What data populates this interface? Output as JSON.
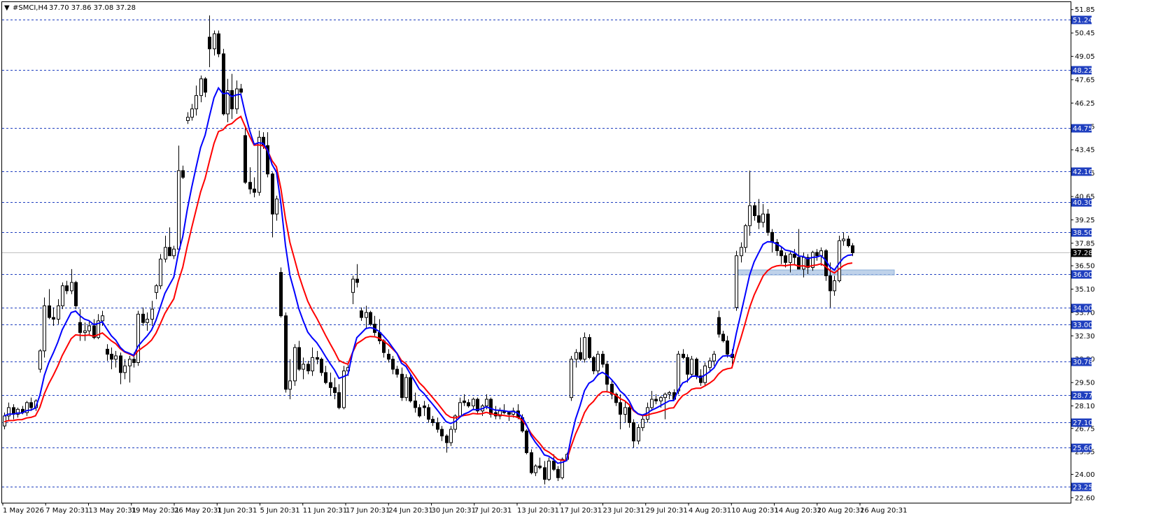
{
  "header": {
    "symbol_tf": "#SMCI,H4",
    "ohlc": "37.70 37.86 37.08 37.28"
  },
  "colors": {
    "background": "#ffffff",
    "frame": "#000000",
    "grid": "#1f3fbf",
    "level_tag": "#1f3fbf",
    "price_line": "#c0c0c0",
    "bull_body": "#ffffff",
    "bear_body": "#000000",
    "ma_fast": "#0000ff",
    "ma_slow": "#ff0000",
    "zone": "#a9c3e3"
  },
  "chart_data": {
    "type": "candlestick",
    "symbol": "#SMCI",
    "timeframe": "H4",
    "ylim": [
      22.3,
      52.3
    ],
    "y_ticks": [
      "51.85",
      "50.45",
      "49.05",
      "47.65",
      "46.25",
      "44.85",
      "43.45",
      "42.05",
      "40.65",
      "39.25",
      "37.85",
      "36.50",
      "35.10",
      "33.70",
      "32.30",
      "30.90",
      "29.50",
      "28.10",
      "26.75",
      "25.35",
      "24.00",
      "22.60"
    ],
    "level_lines": [
      "51.24",
      "48.22",
      "44.75",
      "42.16",
      "40.30",
      "38.50",
      "36.00",
      "34.00",
      "33.00",
      "30.78",
      "28.77",
      "27.10",
      "25.60",
      "23.25"
    ],
    "current_price": "37.28",
    "x_labels": [
      "1 May 2026",
      "7 May 20:31",
      "13 May 20:31",
      "19 May 20:31",
      "26 May 20:31",
      "1 Jun 20:31",
      "5 Jun 20:31",
      "11 Jun 20:31",
      "17 Jun 20:31",
      "24 Jun 20:31",
      "30 Jun 20:31",
      "7 Jul 20:31",
      "13 Jul 20:31",
      "17 Jul 20:31",
      "23 Jul 20:31",
      "29 Jul 20:31",
      "4 Aug 20:31",
      "10 Aug 20:31",
      "14 Aug 20:31",
      "20 Aug 20:31",
      "26 Aug 20:31"
    ],
    "highlight_zone": {
      "low": 35.95,
      "high": 36.25
    },
    "ohlc": [
      [
        26.9,
        27.7,
        26.7,
        27.5
      ],
      [
        27.5,
        28.3,
        27.2,
        28.0
      ],
      [
        28.0,
        28.2,
        27.3,
        27.6
      ],
      [
        27.6,
        28.0,
        27.4,
        27.9
      ],
      [
        27.9,
        28.1,
        27.6,
        27.7
      ],
      [
        27.7,
        28.4,
        27.5,
        28.3
      ],
      [
        28.3,
        28.6,
        27.8,
        28.0
      ],
      [
        28.0,
        28.5,
        27.8,
        28.4
      ],
      [
        30.3,
        31.5,
        30.1,
        31.4
      ],
      [
        31.4,
        34.6,
        31.0,
        34.1
      ],
      [
        34.1,
        35.1,
        33.3,
        33.4
      ],
      [
        33.4,
        34.0,
        32.9,
        33.3
      ],
      [
        33.3,
        34.5,
        33.0,
        34.1
      ],
      [
        34.1,
        35.5,
        33.9,
        35.3
      ],
      [
        35.3,
        35.6,
        34.8,
        35.0
      ],
      [
        35.0,
        36.3,
        34.8,
        35.5
      ],
      [
        35.5,
        35.6,
        33.9,
        34.1
      ],
      [
        33.1,
        33.9,
        32.0,
        32.5
      ],
      [
        32.5,
        33.1,
        32.0,
        32.6
      ],
      [
        32.6,
        33.2,
        32.3,
        32.9
      ],
      [
        32.9,
        33.3,
        32.1,
        32.2
      ],
      [
        32.2,
        33.6,
        32.1,
        33.2
      ],
      [
        33.2,
        33.8,
        32.9,
        33.5
      ],
      [
        31.5,
        31.8,
        30.8,
        31.2
      ],
      [
        31.2,
        31.6,
        30.3,
        30.9
      ],
      [
        30.9,
        31.4,
        30.4,
        31.1
      ],
      [
        31.1,
        31.3,
        29.4,
        30.1
      ],
      [
        30.1,
        30.9,
        29.7,
        30.5
      ],
      [
        30.5,
        31.1,
        29.5,
        30.9
      ],
      [
        30.9,
        31.3,
        30.4,
        30.7
      ],
      [
        30.7,
        33.8,
        30.5,
        33.6
      ],
      [
        33.6,
        34.0,
        32.9,
        33.1
      ],
      [
        33.1,
        33.7,
        32.6,
        33.3
      ],
      [
        33.3,
        34.4,
        32.9,
        33.9
      ],
      [
        34.9,
        35.4,
        34.5,
        35.3
      ],
      [
        35.3,
        37.2,
        35.1,
        36.9
      ],
      [
        36.9,
        38.3,
        36.7,
        37.6
      ],
      [
        37.6,
        38.8,
        37.2,
        37.1
      ],
      [
        37.1,
        37.7,
        36.9,
        37.5
      ],
      [
        37.5,
        43.7,
        37.3,
        42.2
      ],
      [
        42.2,
        42.5,
        41.7,
        41.8
      ],
      [
        45.2,
        45.7,
        45.0,
        45.4
      ],
      [
        45.4,
        46.2,
        45.2,
        45.9
      ],
      [
        45.9,
        47.3,
        45.5,
        46.7
      ],
      [
        46.7,
        47.9,
        46.3,
        47.7
      ],
      [
        47.7,
        47.8,
        46.6,
        46.9
      ],
      [
        50.2,
        51.5,
        48.4,
        49.5
      ],
      [
        49.5,
        50.6,
        49.1,
        50.4
      ],
      [
        50.4,
        50.6,
        49.0,
        49.2
      ],
      [
        49.2,
        49.5,
        45.5,
        45.6
      ],
      [
        45.6,
        47.7,
        45.1,
        47.0
      ],
      [
        47.0,
        48.0,
        45.3,
        45.9
      ],
      [
        45.9,
        47.6,
        45.6,
        47.1
      ],
      [
        47.1,
        47.4,
        46.8,
        46.9
      ],
      [
        44.3,
        44.9,
        41.4,
        41.5
      ],
      [
        41.5,
        42.4,
        40.8,
        41.1
      ],
      [
        41.1,
        41.8,
        40.6,
        40.9
      ],
      [
        40.9,
        44.6,
        40.7,
        44.2
      ],
      [
        44.2,
        44.5,
        43.5,
        43.7
      ],
      [
        43.7,
        44.5,
        41.8,
        42.0
      ],
      [
        42.0,
        42.1,
        38.2,
        39.6
      ],
      [
        39.6,
        40.7,
        39.2,
        40.5
      ],
      [
        36.1,
        36.4,
        33.4,
        33.5
      ],
      [
        33.5,
        33.7,
        28.9,
        29.1
      ],
      [
        29.1,
        30.9,
        28.5,
        29.6
      ],
      [
        29.6,
        31.8,
        29.3,
        31.6
      ],
      [
        31.6,
        32.0,
        30.2,
        30.3
      ],
      [
        30.3,
        31.0,
        29.7,
        30.6
      ],
      [
        30.6,
        30.8,
        30.0,
        30.2
      ],
      [
        30.2,
        31.6,
        29.9,
        31.0
      ],
      [
        31.0,
        31.4,
        30.6,
        30.9
      ],
      [
        30.9,
        31.0,
        29.9,
        30.1
      ],
      [
        30.1,
        30.5,
        29.4,
        29.5
      ],
      [
        29.5,
        30.1,
        28.7,
        29.2
      ],
      [
        29.2,
        29.8,
        28.5,
        28.9
      ],
      [
        28.9,
        29.4,
        27.9,
        28.0
      ],
      [
        28.0,
        30.5,
        27.9,
        30.2
      ],
      [
        30.2,
        30.6,
        29.9,
        30.4
      ],
      [
        34.9,
        35.9,
        34.2,
        35.7
      ],
      [
        35.7,
        36.6,
        35.2,
        35.5
      ],
      [
        33.8,
        34.0,
        33.2,
        33.4
      ],
      [
        33.4,
        34.1,
        32.7,
        33.7
      ],
      [
        33.7,
        33.8,
        32.9,
        33.0
      ],
      [
        33.0,
        33.5,
        32.3,
        32.5
      ],
      [
        32.5,
        33.3,
        31.8,
        32.0
      ],
      [
        32.0,
        32.1,
        31.0,
        31.3
      ],
      [
        31.2,
        31.5,
        30.7,
        30.9
      ],
      [
        30.9,
        31.1,
        30.0,
        30.3
      ],
      [
        30.3,
        30.5,
        29.8,
        30.0
      ],
      [
        30.0,
        30.4,
        28.4,
        28.6
      ],
      [
        28.6,
        30.0,
        28.4,
        29.8
      ],
      [
        29.8,
        30.0,
        28.3,
        28.4
      ],
      [
        28.4,
        28.9,
        27.7,
        28.0
      ],
      [
        28.0,
        28.2,
        27.4,
        27.5
      ],
      [
        28.1,
        28.4,
        27.5,
        28.0
      ],
      [
        28.0,
        28.2,
        27.1,
        27.3
      ],
      [
        27.3,
        27.5,
        26.9,
        27.1
      ],
      [
        27.1,
        27.4,
        26.5,
        26.7
      ],
      [
        26.7,
        26.9,
        26.0,
        26.3
      ],
      [
        26.3,
        26.4,
        25.3,
        25.9
      ],
      [
        25.9,
        26.9,
        25.7,
        26.7
      ],
      [
        26.7,
        27.6,
        26.5,
        27.5
      ],
      [
        27.5,
        28.6,
        27.4,
        28.3
      ],
      [
        28.4,
        28.8,
        28.1,
        28.3
      ],
      [
        28.3,
        28.5,
        28.0,
        28.1
      ],
      [
        28.1,
        28.6,
        27.9,
        28.5
      ],
      [
        28.5,
        28.6,
        27.6,
        27.8
      ],
      [
        27.8,
        28.2,
        27.5,
        28.1
      ],
      [
        28.1,
        28.8,
        27.9,
        28.5
      ],
      [
        28.5,
        28.6,
        27.4,
        27.6
      ],
      [
        27.7,
        28.1,
        27.3,
        27.5
      ],
      [
        27.5,
        28.0,
        27.3,
        27.8
      ],
      [
        27.8,
        28.2,
        27.6,
        27.7
      ],
      [
        27.7,
        27.8,
        27.2,
        27.6
      ],
      [
        27.6,
        28.0,
        27.4,
        27.8
      ],
      [
        27.8,
        28.2,
        27.3,
        27.4
      ],
      [
        27.4,
        27.6,
        26.5,
        26.6
      ],
      [
        26.6,
        26.7,
        25.2,
        25.3
      ],
      [
        25.3,
        25.5,
        24.0,
        24.1
      ],
      [
        24.1,
        24.6,
        23.9,
        24.5
      ],
      [
        24.5,
        25.0,
        24.3,
        24.4
      ],
      [
        24.4,
        24.8,
        23.4,
        23.7
      ],
      [
        23.7,
        25.0,
        23.6,
        24.8
      ],
      [
        24.8,
        25.2,
        24.2,
        24.3
      ],
      [
        24.3,
        24.5,
        23.6,
        23.8
      ],
      [
        23.8,
        25.0,
        23.7,
        24.9
      ],
      [
        24.9,
        25.3,
        24.8,
        25.2
      ],
      [
        28.6,
        31.1,
        28.4,
        30.9
      ],
      [
        30.9,
        31.5,
        30.4,
        31.3
      ],
      [
        31.3,
        32.2,
        30.8,
        30.9
      ],
      [
        30.9,
        32.5,
        30.7,
        32.2
      ],
      [
        32.2,
        32.4,
        30.9,
        31.0
      ],
      [
        31.0,
        31.1,
        30.0,
        30.2
      ],
      [
        30.2,
        31.4,
        29.9,
        31.2
      ],
      [
        31.2,
        31.4,
        30.4,
        30.6
      ],
      [
        30.6,
        30.8,
        28.9,
        29.4
      ],
      [
        29.4,
        29.7,
        28.5,
        28.8
      ],
      [
        28.8,
        28.9,
        28.1,
        28.3
      ],
      [
        28.3,
        28.8,
        26.7,
        27.6
      ],
      [
        27.6,
        28.4,
        27.1,
        28.0
      ],
      [
        28.0,
        28.2,
        26.8,
        27.1
      ],
      [
        27.1,
        27.3,
        25.6,
        26.0
      ],
      [
        26.0,
        27.0,
        25.8,
        26.8
      ],
      [
        26.8,
        27.5,
        26.6,
        27.3
      ],
      [
        27.3,
        28.3,
        27.1,
        28.0
      ],
      [
        28.0,
        29.0,
        27.8,
        28.5
      ],
      [
        28.5,
        28.8,
        28.2,
        28.4
      ],
      [
        28.4,
        28.7,
        28.0,
        28.6
      ],
      [
        28.6,
        28.9,
        27.3,
        28.8
      ],
      [
        28.8,
        29.0,
        28.5,
        28.9
      ],
      [
        28.9,
        29.1,
        28.4,
        28.5
      ],
      [
        29.0,
        31.4,
        28.8,
        31.2
      ],
      [
        31.2,
        31.5,
        30.9,
        31.0
      ],
      [
        31.0,
        31.2,
        29.5,
        30.0
      ],
      [
        30.0,
        31.1,
        29.8,
        30.9
      ],
      [
        30.9,
        31.0,
        29.7,
        29.9
      ],
      [
        29.9,
        30.3,
        29.3,
        29.5
      ],
      [
        29.5,
        30.7,
        29.3,
        30.5
      ],
      [
        30.4,
        31.0,
        30.1,
        30.8
      ],
      [
        30.8,
        31.4,
        30.5,
        31.2
      ],
      [
        33.4,
        33.8,
        32.2,
        32.4
      ],
      [
        32.4,
        32.6,
        31.9,
        32.0
      ],
      [
        32.0,
        32.3,
        31.0,
        31.2
      ],
      [
        31.2,
        31.5,
        30.6,
        31.0
      ],
      [
        34.0,
        37.4,
        33.8,
        37.1
      ],
      [
        37.1,
        37.9,
        36.7,
        37.6
      ],
      [
        37.6,
        39.0,
        37.3,
        38.9
      ],
      [
        38.9,
        42.2,
        38.3,
        40.1
      ],
      [
        40.1,
        40.3,
        39.2,
        39.5
      ],
      [
        39.5,
        40.5,
        38.7,
        39.1
      ],
      [
        39.1,
        40.2,
        38.8,
        39.6
      ],
      [
        39.6,
        39.9,
        38.3,
        38.5
      ],
      [
        38.5,
        38.7,
        37.3,
        37.9
      ],
      [
        37.9,
        38.1,
        37.1,
        37.4
      ],
      [
        37.4,
        37.6,
        36.6,
        37.1
      ],
      [
        37.1,
        37.3,
        36.4,
        36.7
      ],
      [
        36.7,
        37.4,
        36.1,
        37.2
      ],
      [
        37.2,
        37.5,
        36.6,
        37.0
      ],
      [
        37.0,
        38.7,
        36.5,
        36.3
      ],
      [
        36.3,
        37.3,
        35.8,
        37.0
      ],
      [
        37.0,
        37.2,
        36.0,
        36.4
      ],
      [
        36.4,
        37.4,
        36.2,
        37.3
      ],
      [
        37.3,
        37.5,
        36.8,
        37.1
      ],
      [
        37.1,
        37.6,
        36.5,
        37.4
      ],
      [
        37.4,
        37.5,
        35.6,
        35.9
      ],
      [
        35.9,
        36.7,
        34.0,
        35.0
      ],
      [
        35.0,
        35.9,
        34.7,
        35.6
      ],
      [
        35.6,
        38.3,
        35.5,
        38.0
      ],
      [
        38.0,
        38.5,
        37.7,
        38.1
      ],
      [
        38.1,
        38.3,
        37.6,
        37.7
      ],
      [
        37.7,
        37.86,
        37.08,
        37.28
      ]
    ]
  }
}
